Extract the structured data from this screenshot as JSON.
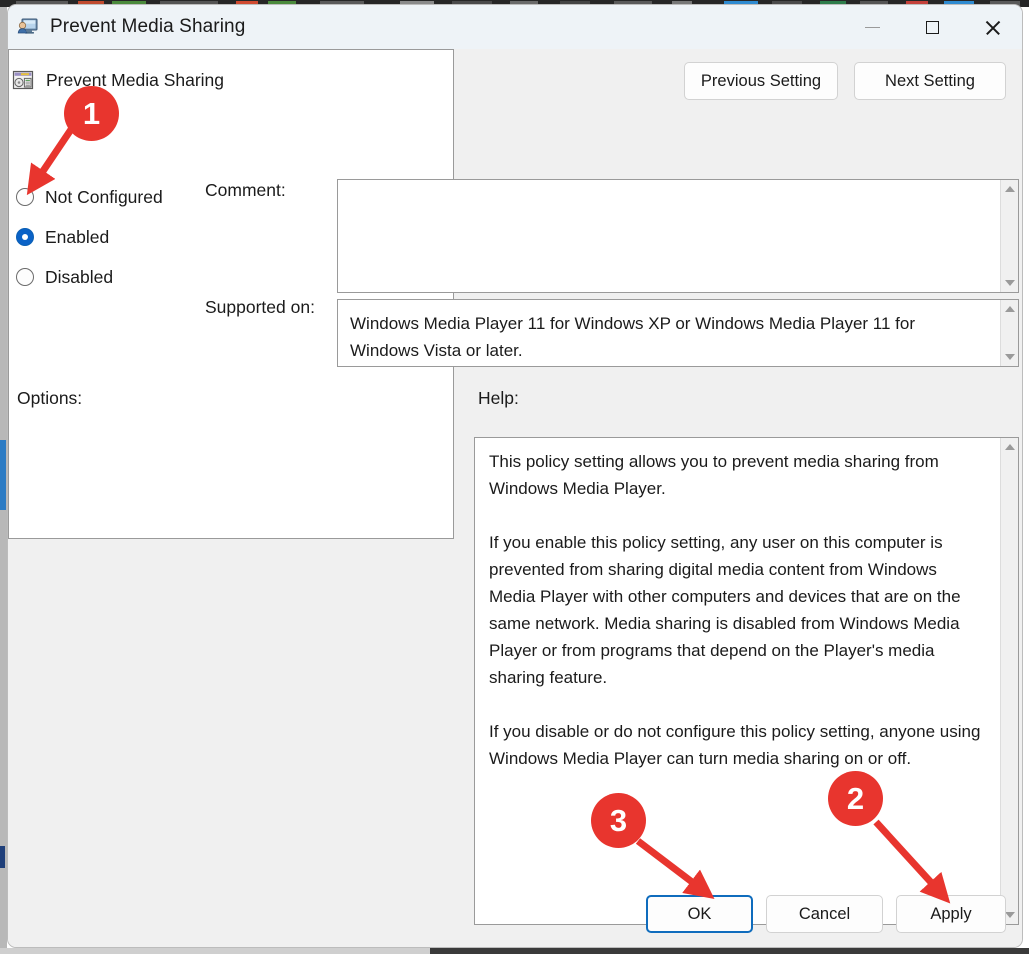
{
  "window": {
    "title": "Prevent Media Sharing",
    "title_icon": "user-monitor-icon",
    "minimize_label": "Minimize",
    "maximize_label": "Maximize",
    "close_label": "Close"
  },
  "header": {
    "setting_name": "Prevent Media Sharing",
    "setting_icon": "media-policy-icon",
    "previous_setting_label": "Previous Setting",
    "next_setting_label": "Next Setting"
  },
  "state_options": {
    "items": [
      {
        "label": "Not Configured",
        "selected": false
      },
      {
        "label": "Enabled",
        "selected": true
      },
      {
        "label": "Disabled",
        "selected": false
      }
    ]
  },
  "fields": {
    "comment_label": "Comment:",
    "comment_value": "",
    "supported_on_label": "Supported on:",
    "supported_on_value": "Windows Media Player 11 for Windows XP or Windows Media Player 11 for Windows Vista or later."
  },
  "panels": {
    "options_label": "Options:",
    "options_value": "",
    "help_label": "Help:",
    "help_paragraphs": [
      "This policy setting allows you to prevent media sharing from Windows Media Player.",
      "If you enable this policy setting, any user on this computer is prevented from sharing digital media content from Windows Media Player with other computers and devices that are on the same network. Media sharing is disabled from Windows Media Player or from programs that depend on the Player's media sharing feature.",
      "If you disable or do not configure this policy setting, anyone using Windows Media Player can turn media sharing on or off."
    ]
  },
  "footer": {
    "ok_label": "OK",
    "cancel_label": "Cancel",
    "apply_label": "Apply"
  },
  "annotations": {
    "accent_color": "#e8352e",
    "markers": [
      {
        "number": "1",
        "points_to": "Enabled radio button"
      },
      {
        "number": "2",
        "points_to": "Apply button"
      },
      {
        "number": "3",
        "points_to": "OK button"
      }
    ]
  }
}
